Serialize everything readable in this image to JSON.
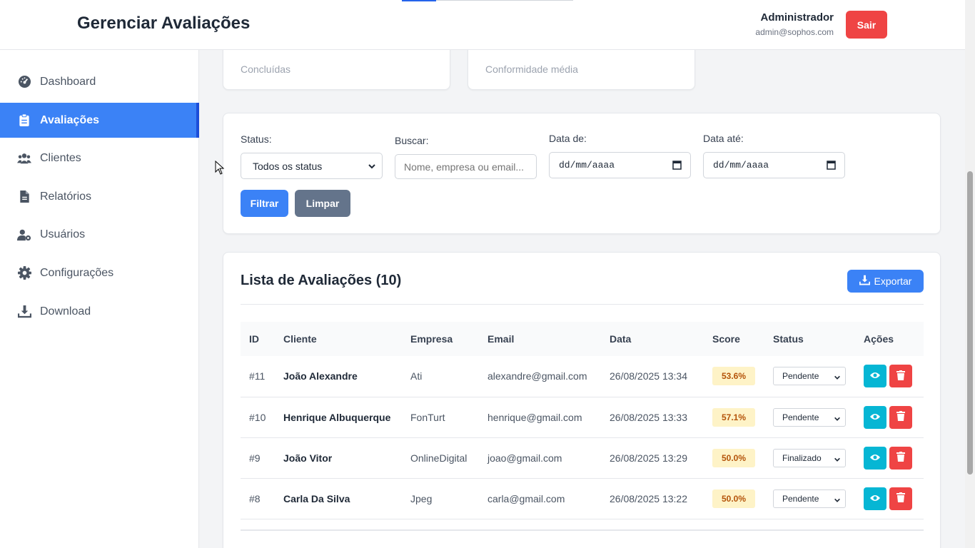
{
  "header": {
    "title": "Gerenciar Avaliações",
    "user_name": "Administrador",
    "user_email": "admin@sophos.com",
    "logout_label": "Sair"
  },
  "sidebar": {
    "items": [
      {
        "label": "Dashboard",
        "icon": "dashboard-icon"
      },
      {
        "label": "Avaliações",
        "icon": "clipboard-icon",
        "active": true
      },
      {
        "label": "Clientes",
        "icon": "users-icon"
      },
      {
        "label": "Relatórios",
        "icon": "document-icon"
      },
      {
        "label": "Usuários",
        "icon": "user-cog-icon"
      },
      {
        "label": "Configurações",
        "icon": "gear-icon"
      },
      {
        "label": "Download",
        "icon": "download-icon"
      }
    ]
  },
  "stats": {
    "completed_label": "Concluídas",
    "compliance_label": "Conformidade média"
  },
  "filters": {
    "status_label": "Status:",
    "status_value": "Todos os status",
    "search_label": "Buscar:",
    "search_placeholder": "Nome, empresa ou email...",
    "date_from_label": "Data de:",
    "date_from_value": "dd/mm/aaaa",
    "date_to_label": "Data até:",
    "date_to_value": "dd/mm/aaaa",
    "filter_button": "Filtrar",
    "clear_button": "Limpar"
  },
  "list": {
    "title": "Lista de Avaliações (10)",
    "export_button": "Exportar",
    "columns": [
      "ID",
      "Cliente",
      "Empresa",
      "Email",
      "Data",
      "Score",
      "Status",
      "Ações"
    ],
    "rows": [
      {
        "id": "#11",
        "client": "João Alexandre",
        "company": "Ati",
        "email": "alexandre@gmail.com",
        "date": "26/08/2025 13:34",
        "score": "53.6%",
        "status": "Pendente"
      },
      {
        "id": "#10",
        "client": "Henrique Albuquerque",
        "company": "FonTurt",
        "email": "henrique@gmail.com",
        "date": "26/08/2025 13:33",
        "score": "57.1%",
        "status": "Pendente"
      },
      {
        "id": "#9",
        "client": "João Vitor",
        "company": "OnlineDigital",
        "email": "joao@gmail.com",
        "date": "26/08/2025 13:29",
        "score": "50.0%",
        "status": "Finalizado"
      },
      {
        "id": "#8",
        "client": "Carla Da Silva",
        "company": "Jpeg",
        "email": "carla@gmail.com",
        "date": "26/08/2025 13:22",
        "score": "50.0%",
        "status": "Pendente"
      }
    ]
  },
  "colors": {
    "primary": "#3b82f6",
    "danger": "#ef4444",
    "info": "#06b6d4",
    "secondary": "#64748b",
    "score_bg": "#fef3c7"
  }
}
